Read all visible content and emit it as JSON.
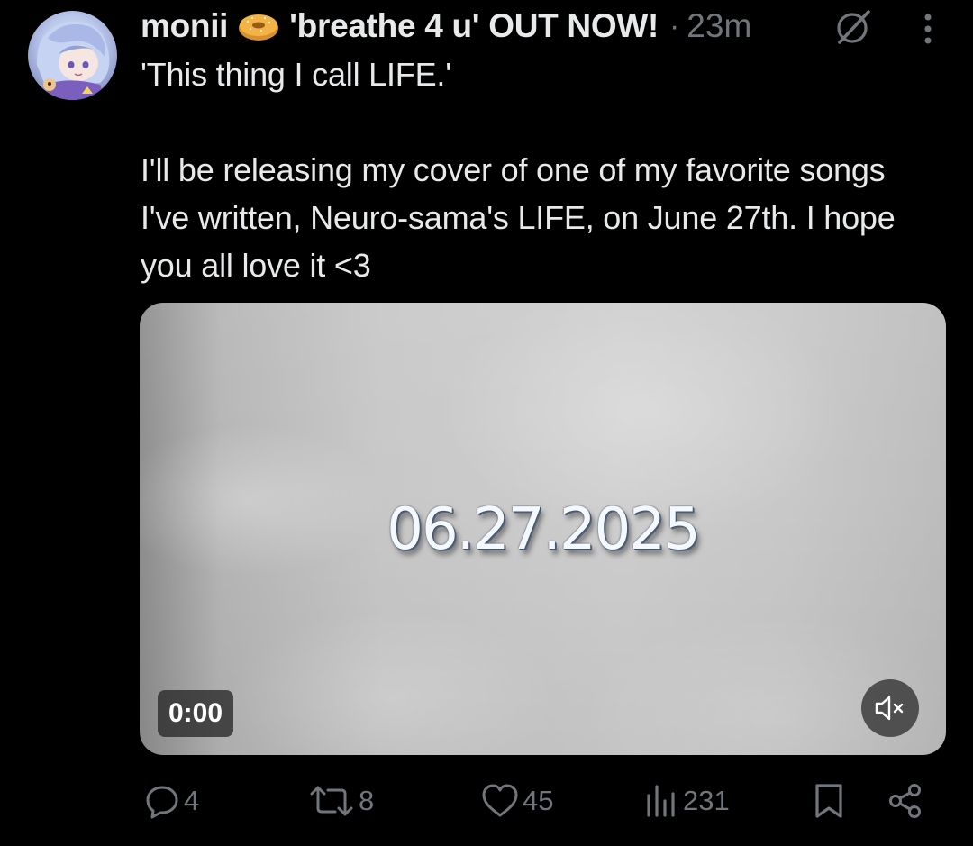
{
  "tweet": {
    "display_name": "monii",
    "name_suffix": "'breathe 4 u' OUT NOW!",
    "separator": "·",
    "time": "23m",
    "body": "'This thing I call LIFE.'\n\nI'll be releasing my cover of one of my favorite songs I've written, Neuro-sama's LIFE, on June 27th. I hope you all love it <3"
  },
  "media": {
    "overlay_text": "06.27.2025",
    "video_time": "0:00",
    "muted": true
  },
  "actions": {
    "replies": "4",
    "reposts": "8",
    "likes": "45",
    "views": "231"
  },
  "icons": {
    "emoji": "bagel-emoji",
    "grok": "grok-icon",
    "more": "more-vertical-icon",
    "reply": "reply-icon",
    "repost": "repost-icon",
    "like": "heart-icon",
    "views": "views-icon",
    "bookmark": "bookmark-icon",
    "share": "share-icon",
    "mute": "mute-icon"
  },
  "colors": {
    "background": "#000000",
    "text": "#e7e9ea",
    "secondary": "#71767b"
  }
}
